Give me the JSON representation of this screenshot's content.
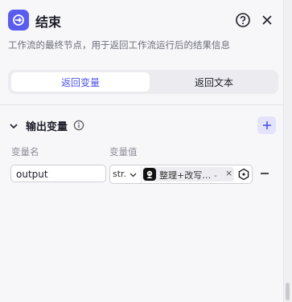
{
  "header": {
    "title": "结束",
    "icon": "end-node-icon",
    "help_icon": "question-circle-icon",
    "close_icon": "close-icon"
  },
  "description": "工作流的最终节点，用于返回工作流运行后的结果信息",
  "tabs": [
    {
      "label": "返回变量",
      "active": true
    },
    {
      "label": "返回文本",
      "active": false
    }
  ],
  "output_section": {
    "title": "输出变量",
    "columns": {
      "name": "变量名",
      "value": "变量值"
    },
    "rows": [
      {
        "name": "output",
        "type": "str.",
        "reference": {
          "text": "整理+改写…",
          "suffix": "-"
        }
      }
    ]
  },
  "colors": {
    "accent": "#4d53e8",
    "node_icon_bg": "#5a5cf0",
    "add_button_bg": "#e3e4fb"
  }
}
